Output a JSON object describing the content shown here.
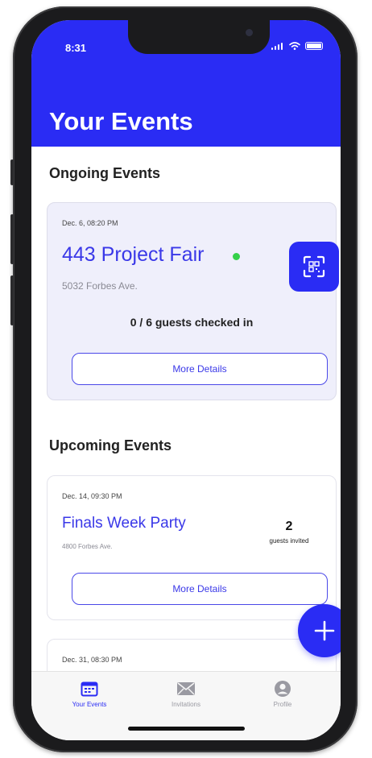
{
  "status_bar": {
    "time": "8:31"
  },
  "header": {
    "title": "Your Events"
  },
  "sections": {
    "ongoing": "Ongoing Events",
    "upcoming": "Upcoming Events"
  },
  "ongoing_event": {
    "date": "Dec. 6, 08:20 PM",
    "title": "443 Project Fair",
    "address": "5032 Forbes Ave.",
    "checkin": "0 / 6 guests checked in",
    "details_label": "More Details"
  },
  "upcoming_events": [
    {
      "date": "Dec. 14, 09:30 PM",
      "title": "Finals Week Party",
      "address": "4800 Forbes Ave.",
      "invited_count": "2",
      "invited_label": "guests invited",
      "details_label": "More Details"
    },
    {
      "date": "Dec. 31, 08:30 PM"
    }
  ],
  "tabs": [
    {
      "label": "Your Events",
      "icon": "calendar-icon",
      "active": true
    },
    {
      "label": "Invitations",
      "icon": "envelope-icon",
      "active": false
    },
    {
      "label": "Profile",
      "icon": "profile-icon",
      "active": false
    }
  ],
  "fab": {
    "icon": "plus-icon"
  },
  "colors": {
    "accent": "#2a2cf4",
    "live": "#35d04a",
    "card_bg": "#efeffb"
  }
}
